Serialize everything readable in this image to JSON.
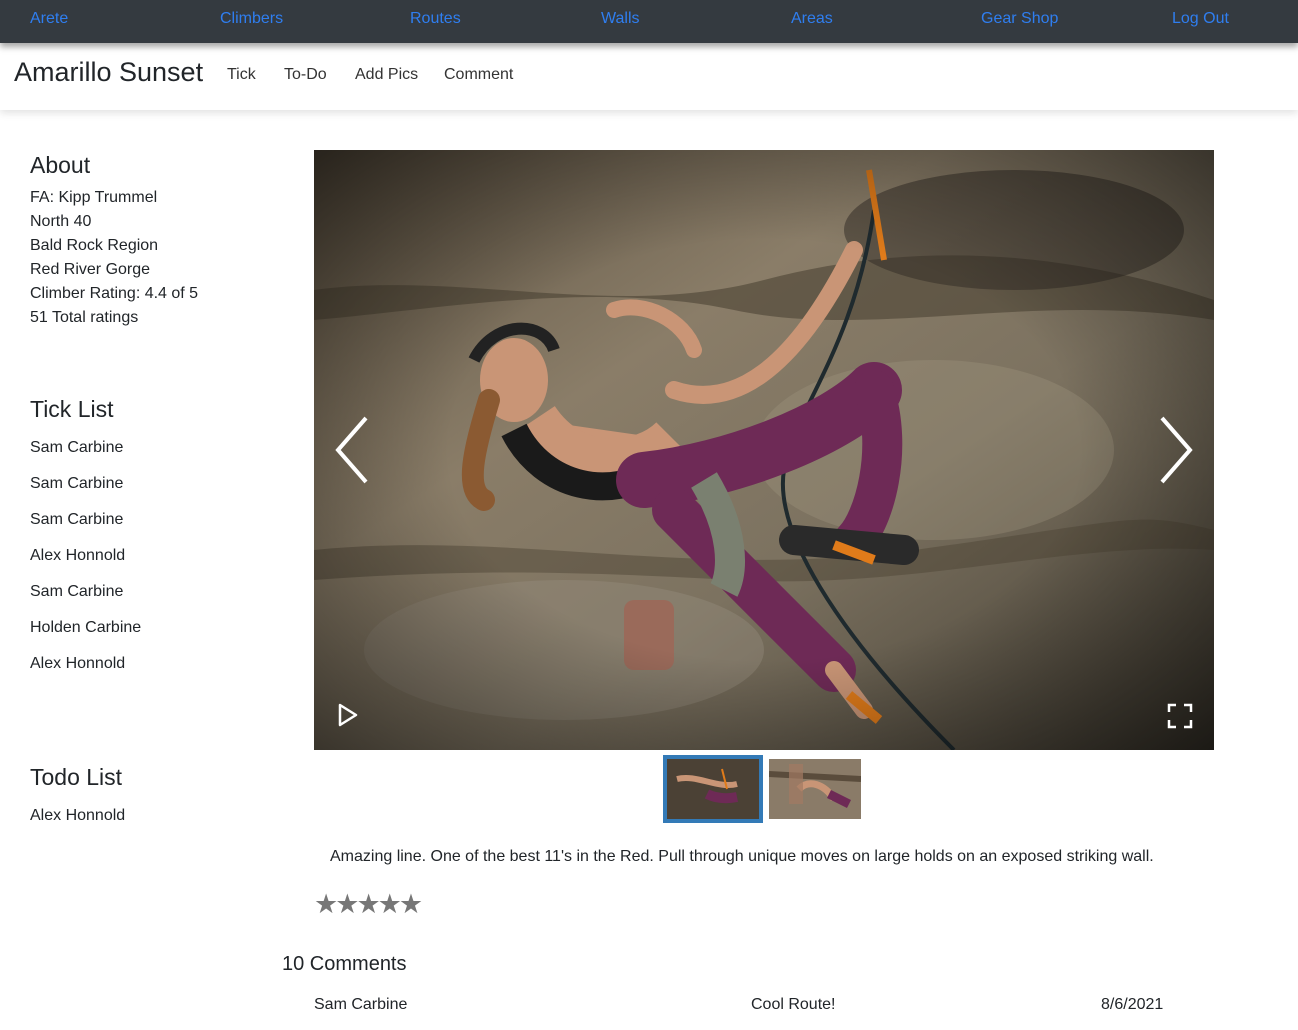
{
  "nav": {
    "items": [
      "Arete",
      "Climbers",
      "Routes",
      "Walls",
      "Areas",
      "Gear Shop",
      "Log Out"
    ]
  },
  "route": {
    "title": "Amarillo Sunset",
    "actions": [
      "Tick",
      "To-Do",
      "Add Pics",
      "Comment"
    ]
  },
  "about": {
    "heading": "About",
    "lines": [
      "FA: Kipp Trummel",
      "North 40",
      "Bald Rock Region",
      "Red River Gorge",
      "Climber Rating: 4.4 of 5",
      "51 Total ratings"
    ]
  },
  "tick_list": {
    "heading": "Tick List",
    "names": [
      "Sam Carbine",
      "Sam Carbine",
      "Sam Carbine",
      "Alex Honnold",
      "Sam Carbine",
      "Holden Carbine",
      "Alex Honnold"
    ]
  },
  "todo_list": {
    "heading": "Todo List",
    "names": [
      "Alex Honnold"
    ]
  },
  "gallery": {
    "active_index": 0,
    "thumbnail_count": 2,
    "icons": {
      "prev": "chevron-left-icon",
      "next": "chevron-right-icon",
      "play": "play-icon",
      "fullscreen": "fullscreen-icon"
    }
  },
  "description": "Amazing line. One of the best 11's in the Red. Pull through unique moves on large holds on an exposed striking wall.",
  "rating_stars": 5,
  "comments": {
    "heading": "10 Comments",
    "items": [
      {
        "author": "Sam Carbine",
        "text": "Cool Route!",
        "date": "8/6/2021"
      }
    ]
  },
  "colors": {
    "nav_bg": "#343a40",
    "nav_link": "#2f7ef0",
    "thumb_active_border": "#337ab7",
    "star": "#777777"
  }
}
